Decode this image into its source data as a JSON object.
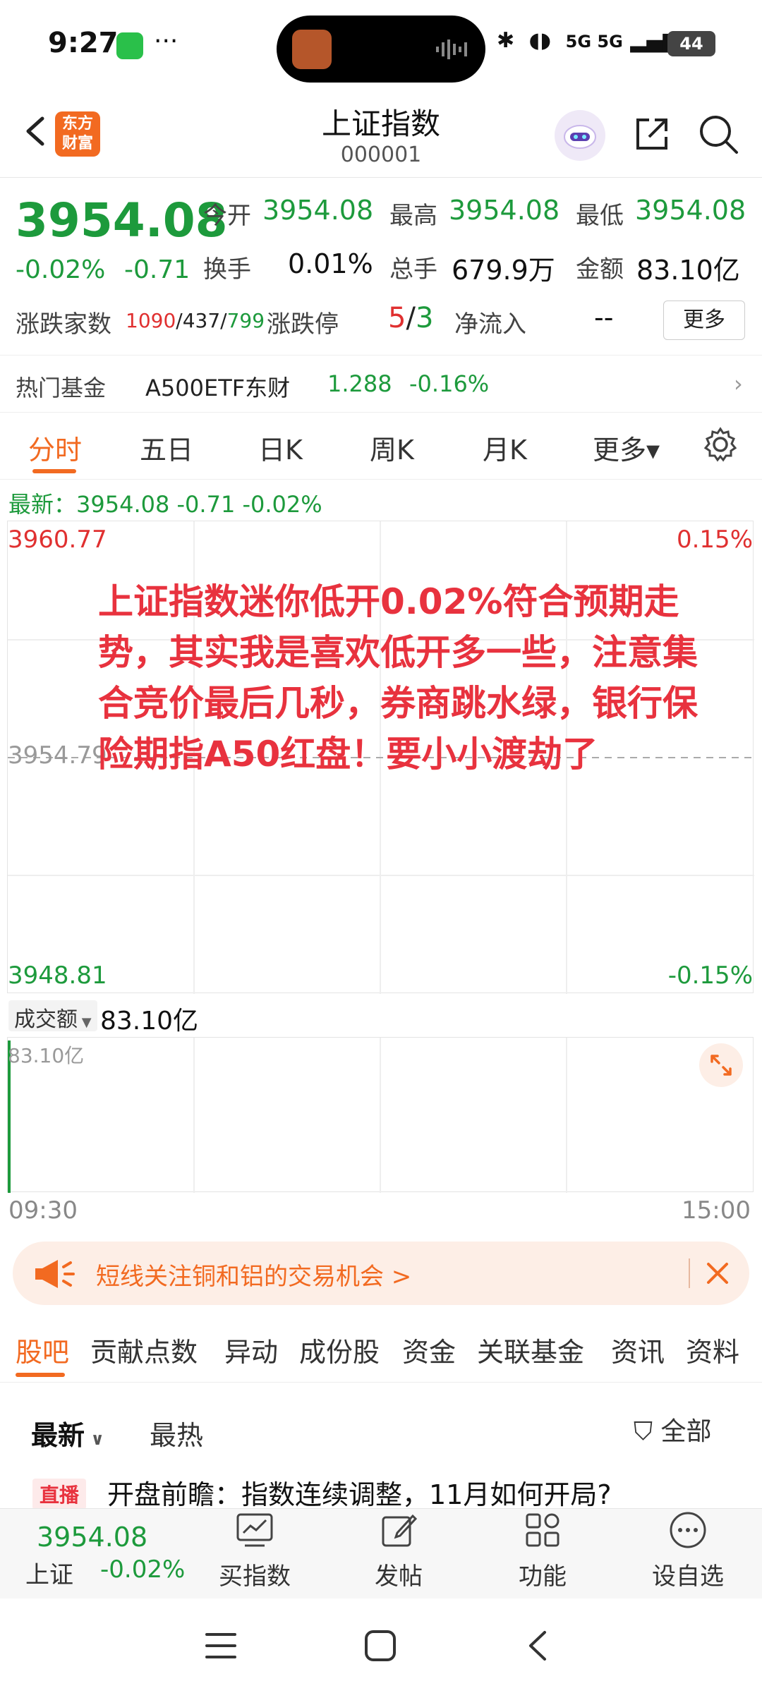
{
  "status_bar": {
    "time": "9:27",
    "dots": "···",
    "network": "5G 5G",
    "battery": "44"
  },
  "header": {
    "logo_text": "东方财富",
    "title": "上证指数",
    "code": "000001"
  },
  "quote": {
    "price": "3954.08",
    "change_pct": "-0.02%",
    "change": "-0.71",
    "open_label": "今开",
    "open": "3954.08",
    "high_label": "最高",
    "high": "3954.08",
    "low_label": "最低",
    "low": "3954.08",
    "turnover_label": "换手",
    "turnover": "0.01%",
    "volume_label": "总手",
    "volume": "679.9万",
    "amount_label": "金额",
    "amount": "83.10亿",
    "breadth_label": "涨跌家数",
    "breadth_up": "1090",
    "breadth_sep1": "/",
    "breadth_flat": "437",
    "breadth_sep2": "/",
    "breadth_down": "799",
    "limit_label": "涨跌停",
    "limit_up": "5",
    "limit_sep": "/",
    "limit_down": "3",
    "netflow_label": "净流入",
    "netflow": "--",
    "more_label": "更多"
  },
  "hot_fund": {
    "label": "热门基金",
    "name": "A500ETF东财",
    "price": "1.288",
    "change": "-0.16%",
    "arrow": "›"
  },
  "chart_tabs": {
    "items": [
      "分时",
      "五日",
      "日K",
      "周K",
      "月K",
      "更多▾"
    ],
    "active": 0
  },
  "latest": {
    "text": "最新：3954.08  -0.71  -0.02%"
  },
  "chart": {
    "top_value": "3960.77",
    "mid_value": "3954.79",
    "bottom_value": "3948.81",
    "top_pct": "0.15%",
    "bottom_pct": "-0.15%",
    "annotation": "上证指数迷你低开0.02%符合预期走势，其实我是喜欢低开多一些，注意集合竞价最后几秒，券商跳水绿，银行保险期指A50红盘！要小小渡劫了",
    "volume_selector": "成交额",
    "volume_value": "83.10亿",
    "volume_axis": "83.10亿",
    "time_start": "09:30",
    "time_end": "15:00"
  },
  "banner": {
    "text": "短线关注铜和铝的交易机会 >"
  },
  "info_tabs": {
    "items": [
      "股吧",
      "贡献点数",
      "异动",
      "成份股",
      "资金",
      "关联基金",
      "资讯",
      "资料"
    ],
    "active": 0
  },
  "feed": {
    "sort_latest": "最新",
    "sort_hot": "最热",
    "filter": "全部",
    "badge": "直播",
    "headline": "开盘前瞻：指数连续调整，11月如何开局?"
  },
  "bottom_bar": {
    "index_price": "3954.08",
    "index_name": "上证",
    "index_change": "-0.02%",
    "buy_index": "买指数",
    "post": "发帖",
    "functions": "功能",
    "watchlist": "设自选"
  }
}
